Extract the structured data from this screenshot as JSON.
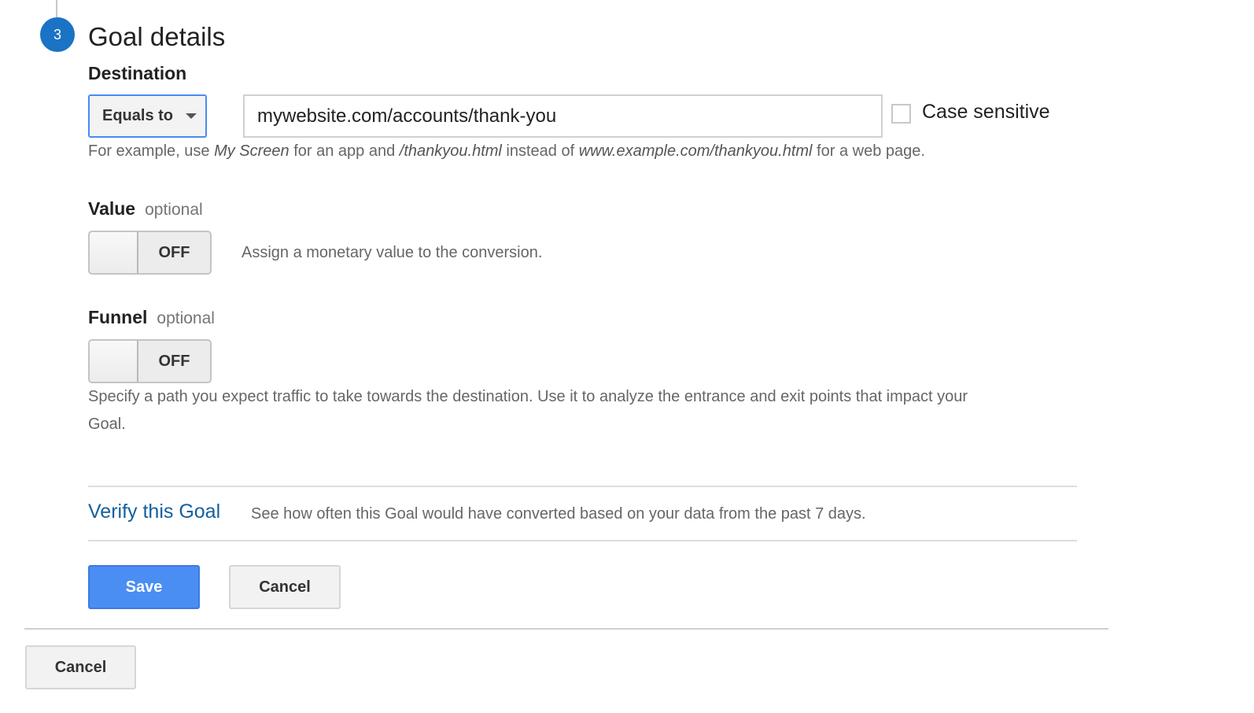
{
  "step": {
    "number": "3",
    "title": "Goal details"
  },
  "destination": {
    "label": "Destination",
    "match_type": "Equals to",
    "value": "mywebsite.com/accounts/thank-you",
    "case_sensitive_label": "Case sensitive",
    "case_sensitive_checked": false,
    "hint": {
      "p1": "For example, use ",
      "e1": "My Screen",
      "p2": " for an app and ",
      "e2": "/thankyou.html",
      "p3": " instead of ",
      "e3": "www.example.com/thankyou.html",
      "p4": " for a web page."
    }
  },
  "value_section": {
    "label": "Value",
    "optional": "optional",
    "toggle_state": "OFF",
    "description": "Assign a monetary value to the conversion."
  },
  "funnel_section": {
    "label": "Funnel",
    "optional": "optional",
    "toggle_state": "OFF",
    "description_line1": "Specify a path you expect traffic to take towards the destination. Use it to analyze the entrance and exit points that impact your",
    "description_line2": "Goal."
  },
  "verify": {
    "link": "Verify this Goal",
    "description": "See how often this Goal would have converted based on your data from the past 7 days."
  },
  "actions": {
    "save": "Save",
    "cancel": "Cancel"
  },
  "footer": {
    "cancel": "Cancel"
  },
  "colors": {
    "accent": "#4a8ef4",
    "step": "#1a73c4",
    "link": "#14609e"
  }
}
